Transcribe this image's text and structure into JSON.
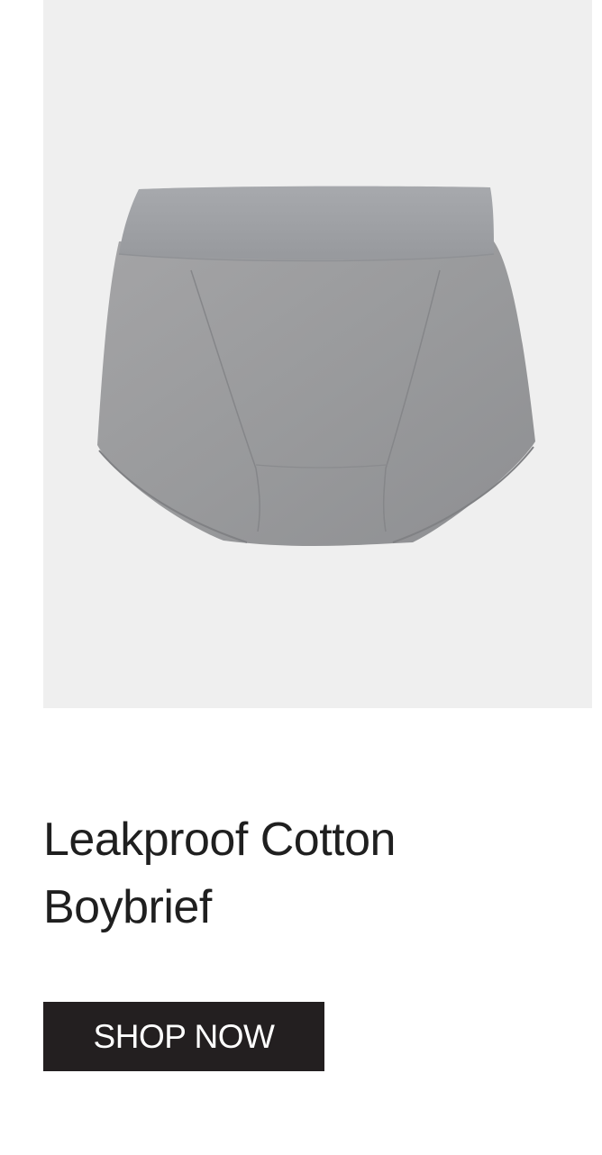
{
  "product": {
    "image_subject": "grey-boybrief-image",
    "colors": {
      "image_background": "#efefef",
      "fabric": "#9a9a9c",
      "waistband": "#9d9fa3"
    },
    "title": "Leakproof Cotton Boybrief",
    "cta_label": "SHOP NOW"
  },
  "colors": {
    "text": "#1f1f1f",
    "button_background": "#231f20",
    "button_text": "#ffffff"
  }
}
